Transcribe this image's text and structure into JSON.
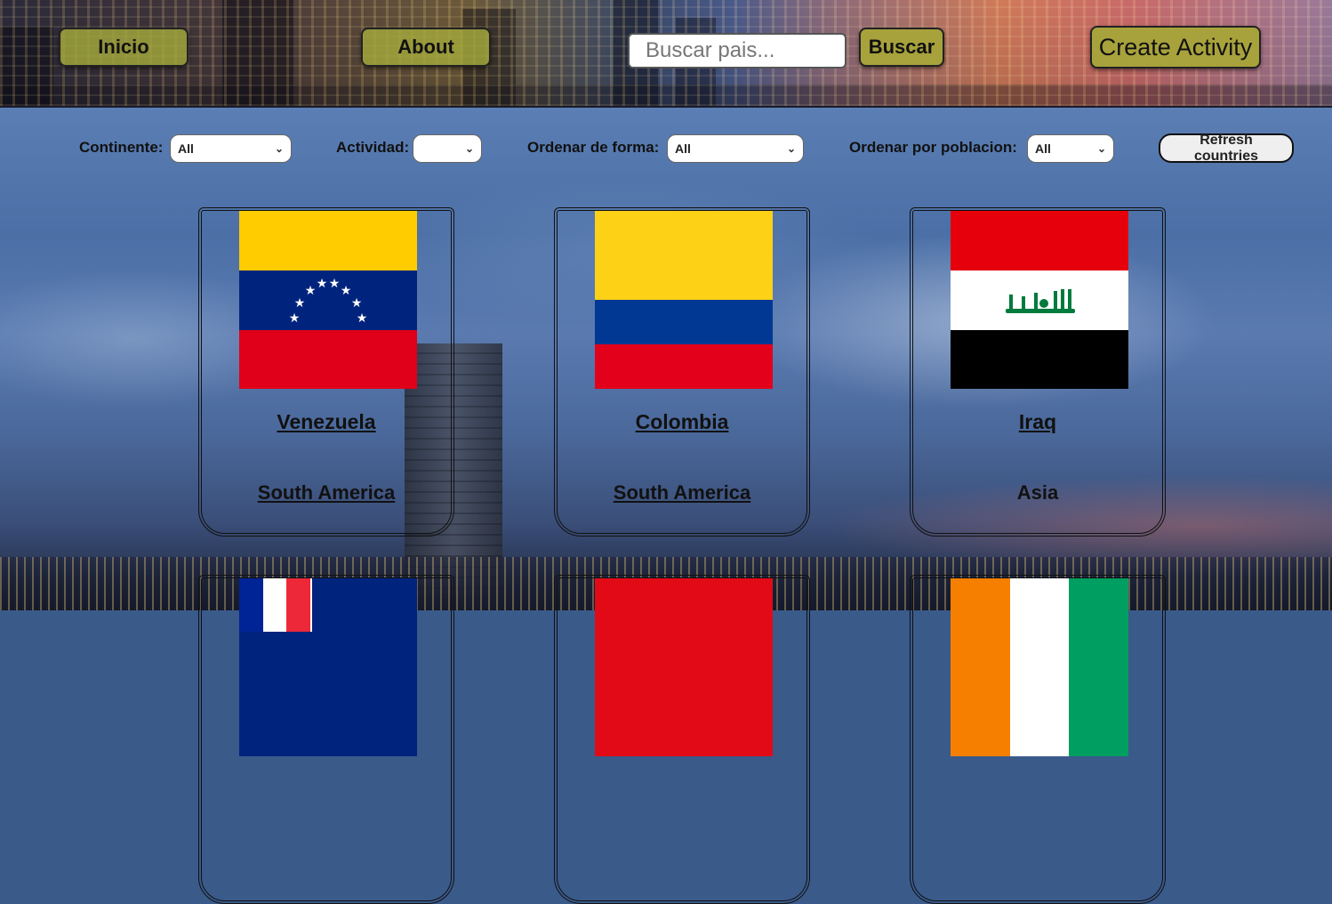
{
  "header": {
    "inicio_label": "Inicio",
    "about_label": "About",
    "search_placeholder": "Buscar pais...",
    "search_button_label": "Buscar",
    "create_activity_label": "Create Activity"
  },
  "filters": {
    "continente_label": "Continente:",
    "continente_value": "All",
    "actividad_label": "Actividad:",
    "actividad_value": "",
    "orden_forma_label": "Ordenar de forma:",
    "orden_forma_value": "All",
    "orden_poblacion_label": "Ordenar por poblacion:",
    "orden_poblacion_value": "All",
    "refresh_label": "Refresh countries"
  },
  "cards": [
    {
      "name": "Venezuela",
      "continent": "South America",
      "flag_icon": "venezuela-flag-icon"
    },
    {
      "name": "Colombia",
      "continent": "South America",
      "flag_icon": "colombia-flag-icon"
    },
    {
      "name": "Iraq",
      "continent": "Asia",
      "flag_icon": "iraq-flag-icon"
    }
  ],
  "colors": {
    "button_olive": "#a8a23c",
    "text_dark": "#111111"
  }
}
